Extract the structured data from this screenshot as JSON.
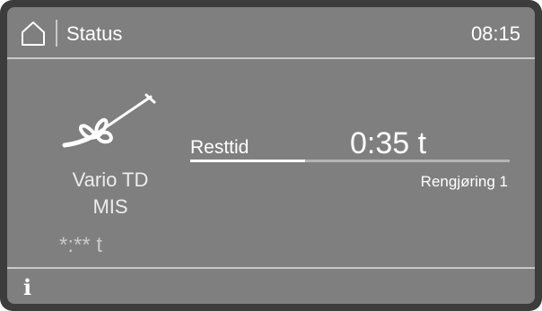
{
  "header": {
    "title": "Status",
    "clock": "08:15",
    "home_icon": "home-icon"
  },
  "program": {
    "icon": "whisk-icon",
    "name": "Vario TD",
    "sub": "MIS",
    "time": "*:** t"
  },
  "remaining": {
    "label": "Resttid",
    "value": "0:35 t",
    "progress": 0.36,
    "phase": "Rengjøring 1"
  },
  "footer": {
    "info_label": "i",
    "info_icon": "info-icon"
  },
  "colors": {
    "screen_bg": "#7f7f7f",
    "text": "#ffffff",
    "divider": "#c9c9c9"
  }
}
